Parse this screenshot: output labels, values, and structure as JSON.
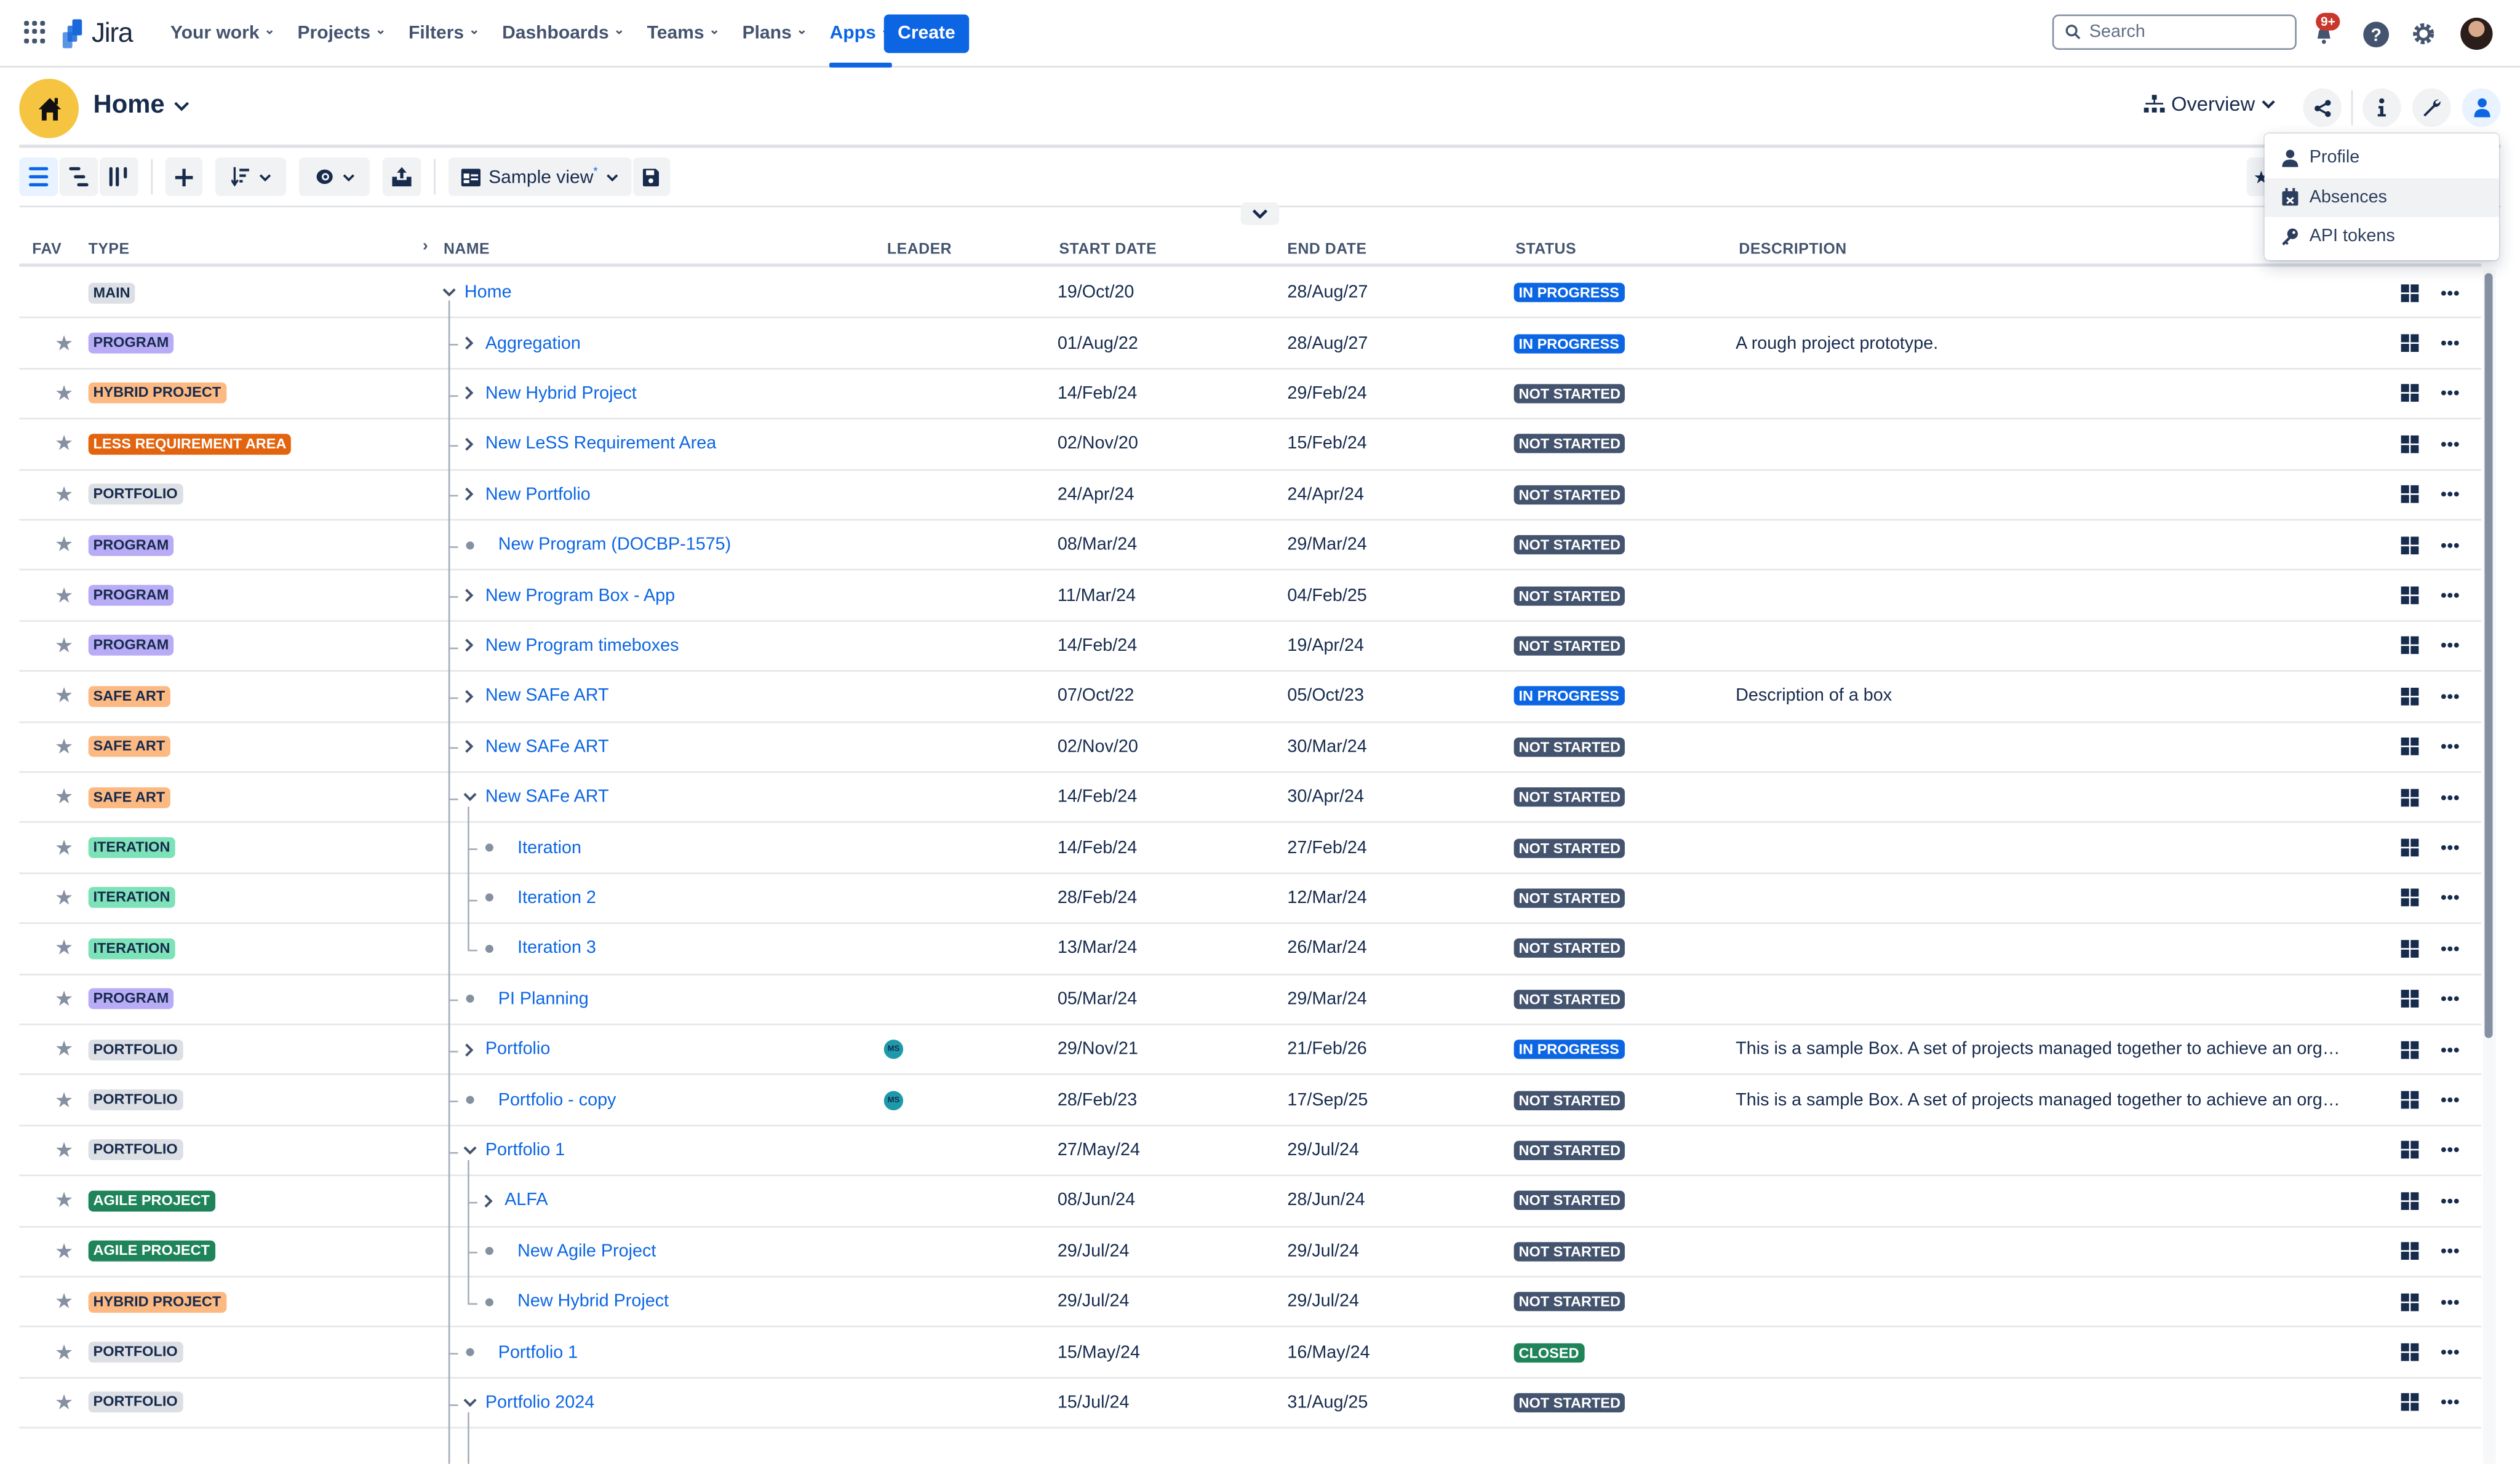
{
  "topnav": {
    "product": "Jira",
    "items": [
      {
        "label": "Your work",
        "active": false
      },
      {
        "label": "Projects",
        "active": false
      },
      {
        "label": "Filters",
        "active": false
      },
      {
        "label": "Dashboards",
        "active": false
      },
      {
        "label": "Teams",
        "active": false
      },
      {
        "label": "Plans",
        "active": false
      },
      {
        "label": "Apps",
        "active": true
      }
    ],
    "create_label": "Create",
    "search_placeholder": "Search",
    "notifications_badge": "9+",
    "icons": [
      "app-switcher-icon",
      "jira-logo",
      "search-icon",
      "notification-bell-icon",
      "help-icon",
      "settings-gear-icon",
      "user-avatar"
    ]
  },
  "header": {
    "title": "Home",
    "view_switcher_label": "Overview",
    "icons": [
      "home-icon",
      "hierarchy-icon",
      "share-icon",
      "info-icon",
      "wrench-icon",
      "user-icon"
    ]
  },
  "toolbar": {
    "view_label": "Sample view",
    "view_modified_marker": "*",
    "icons": [
      "tree-view-icon",
      "indented-list-icon",
      "board-columns-icon",
      "add-icon",
      "sort-icon",
      "visibility-eye-icon",
      "export-icon",
      "view-card-icon",
      "save-icon"
    ]
  },
  "user_menu": {
    "items": [
      {
        "label": "Profile",
        "icon": "person-icon",
        "highlighted": false
      },
      {
        "label": "Absences",
        "icon": "calendar-x-icon",
        "highlighted": true
      },
      {
        "label": "API tokens",
        "icon": "key-icon",
        "highlighted": false
      }
    ]
  },
  "table": {
    "columns": [
      "FAV",
      "TYPE",
      "NAME",
      "LEADER",
      "START DATE",
      "END DATE",
      "STATUS",
      "DESCRIPTION"
    ],
    "type_colors": {
      "MAIN": {
        "bg": "#dcdfe4",
        "fg": "#172b4d"
      },
      "PROGRAM": {
        "bg": "#b8acf6",
        "fg": "#172b4d"
      },
      "HYBRID PROJECT": {
        "bg": "#fdb982",
        "fg": "#172b4d"
      },
      "LESS REQUIREMENT AREA": {
        "bg": "#e2640f",
        "fg": "#ffffff"
      },
      "PORTFOLIO": {
        "bg": "#dcdfe4",
        "fg": "#172b4d"
      },
      "SAFE ART": {
        "bg": "#fdb982",
        "fg": "#172b4d"
      },
      "ITERATION": {
        "bg": "#7ee2b8",
        "fg": "#172b4d"
      },
      "AGILE PROJECT": {
        "bg": "#1f845a",
        "fg": "#ffffff"
      }
    },
    "status_colors": {
      "IN PROGRESS": "#0c66e4",
      "NOT STARTED": "#44546f",
      "CLOSED": "#1f845a"
    },
    "rows": [
      {
        "fav": false,
        "type": "MAIN",
        "name": "Home",
        "depth": 0,
        "node": "expanded",
        "leader": "",
        "start": "19/Oct/20",
        "end": "28/Aug/27",
        "status": "IN PROGRESS",
        "description": ""
      },
      {
        "fav": true,
        "type": "PROGRAM",
        "name": "Aggregation",
        "depth": 1,
        "node": "collapsed",
        "leader": "",
        "start": "01/Aug/22",
        "end": "28/Aug/27",
        "status": "IN PROGRESS",
        "description": "A rough project prototype."
      },
      {
        "fav": true,
        "type": "HYBRID PROJECT",
        "name": "New Hybrid Project",
        "depth": 1,
        "node": "collapsed",
        "leader": "",
        "start": "14/Feb/24",
        "end": "29/Feb/24",
        "status": "NOT STARTED",
        "description": ""
      },
      {
        "fav": true,
        "type": "LESS REQUIREMENT AREA",
        "name": "New LeSS Requirement Area",
        "depth": 1,
        "node": "collapsed",
        "leader": "",
        "start": "02/Nov/20",
        "end": "15/Feb/24",
        "status": "NOT STARTED",
        "description": ""
      },
      {
        "fav": true,
        "type": "PORTFOLIO",
        "name": "New Portfolio",
        "depth": 1,
        "node": "collapsed",
        "leader": "",
        "start": "24/Apr/24",
        "end": "24/Apr/24",
        "status": "NOT STARTED",
        "description": ""
      },
      {
        "fav": true,
        "type": "PROGRAM",
        "name": "New Program (DOCBP-1575)",
        "depth": 1,
        "node": "leaf",
        "leader": "",
        "start": "08/Mar/24",
        "end": "29/Mar/24",
        "status": "NOT STARTED",
        "description": ""
      },
      {
        "fav": true,
        "type": "PROGRAM",
        "name": "New Program Box - App",
        "depth": 1,
        "node": "collapsed",
        "leader": "",
        "start": "11/Mar/24",
        "end": "04/Feb/25",
        "status": "NOT STARTED",
        "description": ""
      },
      {
        "fav": true,
        "type": "PROGRAM",
        "name": "New Program timeboxes",
        "depth": 1,
        "node": "collapsed",
        "leader": "",
        "start": "14/Feb/24",
        "end": "19/Apr/24",
        "status": "NOT STARTED",
        "description": ""
      },
      {
        "fav": true,
        "type": "SAFE ART",
        "name": "New SAFe ART",
        "depth": 1,
        "node": "collapsed",
        "leader": "",
        "start": "07/Oct/22",
        "end": "05/Oct/23",
        "status": "IN PROGRESS",
        "description": "Description of a box"
      },
      {
        "fav": true,
        "type": "SAFE ART",
        "name": "New SAFe ART",
        "depth": 1,
        "node": "collapsed",
        "leader": "",
        "start": "02/Nov/20",
        "end": "30/Mar/24",
        "status": "NOT STARTED",
        "description": ""
      },
      {
        "fav": true,
        "type": "SAFE ART",
        "name": "New SAFe ART",
        "depth": 1,
        "node": "expanded",
        "leader": "",
        "start": "14/Feb/24",
        "end": "30/Apr/24",
        "status": "NOT STARTED",
        "description": ""
      },
      {
        "fav": true,
        "type": "ITERATION",
        "name": "Iteration",
        "depth": 2,
        "node": "leaf",
        "leader": "",
        "start": "14/Feb/24",
        "end": "27/Feb/24",
        "status": "NOT STARTED",
        "description": ""
      },
      {
        "fav": true,
        "type": "ITERATION",
        "name": "Iteration 2",
        "depth": 2,
        "node": "leaf",
        "leader": "",
        "start": "28/Feb/24",
        "end": "12/Mar/24",
        "status": "NOT STARTED",
        "description": ""
      },
      {
        "fav": true,
        "type": "ITERATION",
        "name": "Iteration 3",
        "depth": 2,
        "node": "leaf",
        "last": true,
        "leader": "",
        "start": "13/Mar/24",
        "end": "26/Mar/24",
        "status": "NOT STARTED",
        "description": ""
      },
      {
        "fav": true,
        "type": "PROGRAM",
        "name": "PI Planning",
        "depth": 1,
        "node": "leaf",
        "leader": "",
        "start": "05/Mar/24",
        "end": "29/Mar/24",
        "status": "NOT STARTED",
        "description": ""
      },
      {
        "fav": true,
        "type": "PORTFOLIO",
        "name": "Portfolio",
        "depth": 1,
        "node": "collapsed",
        "leader": "MS",
        "start": "29/Nov/21",
        "end": "21/Feb/26",
        "status": "IN PROGRESS",
        "description": "This is a sample Box. A set of projects managed together to achieve an orga..."
      },
      {
        "fav": true,
        "type": "PORTFOLIO",
        "name": "Portfolio - copy",
        "depth": 1,
        "node": "leaf",
        "leader": "MS",
        "start": "28/Feb/23",
        "end": "17/Sep/25",
        "status": "NOT STARTED",
        "description": "This is a sample Box. A set of projects managed together to achieve an orga..."
      },
      {
        "fav": true,
        "type": "PORTFOLIO",
        "name": "Portfolio 1",
        "depth": 1,
        "node": "expanded",
        "leader": "",
        "start": "27/May/24",
        "end": "29/Jul/24",
        "status": "NOT STARTED",
        "description": ""
      },
      {
        "fav": true,
        "type": "AGILE PROJECT",
        "name": "ALFA",
        "depth": 2,
        "node": "collapsed",
        "leader": "",
        "start": "08/Jun/24",
        "end": "28/Jun/24",
        "status": "NOT STARTED",
        "description": ""
      },
      {
        "fav": true,
        "type": "AGILE PROJECT",
        "name": "New Agile Project",
        "depth": 2,
        "node": "leaf",
        "leader": "",
        "start": "29/Jul/24",
        "end": "29/Jul/24",
        "status": "NOT STARTED",
        "description": ""
      },
      {
        "fav": true,
        "type": "HYBRID PROJECT",
        "name": "New Hybrid Project",
        "depth": 2,
        "node": "leaf",
        "last": true,
        "leader": "",
        "start": "29/Jul/24",
        "end": "29/Jul/24",
        "status": "NOT STARTED",
        "description": ""
      },
      {
        "fav": true,
        "type": "PORTFOLIO",
        "name": "Portfolio 1",
        "depth": 1,
        "node": "leaf",
        "leader": "",
        "start": "15/May/24",
        "end": "16/May/24",
        "status": "CLOSED",
        "description": ""
      },
      {
        "fav": true,
        "type": "PORTFOLIO",
        "name": "Portfolio 2024",
        "depth": 1,
        "node": "expanded",
        "leader": "",
        "start": "15/Jul/24",
        "end": "31/Aug/25",
        "status": "NOT STARTED",
        "description": ""
      }
    ]
  }
}
